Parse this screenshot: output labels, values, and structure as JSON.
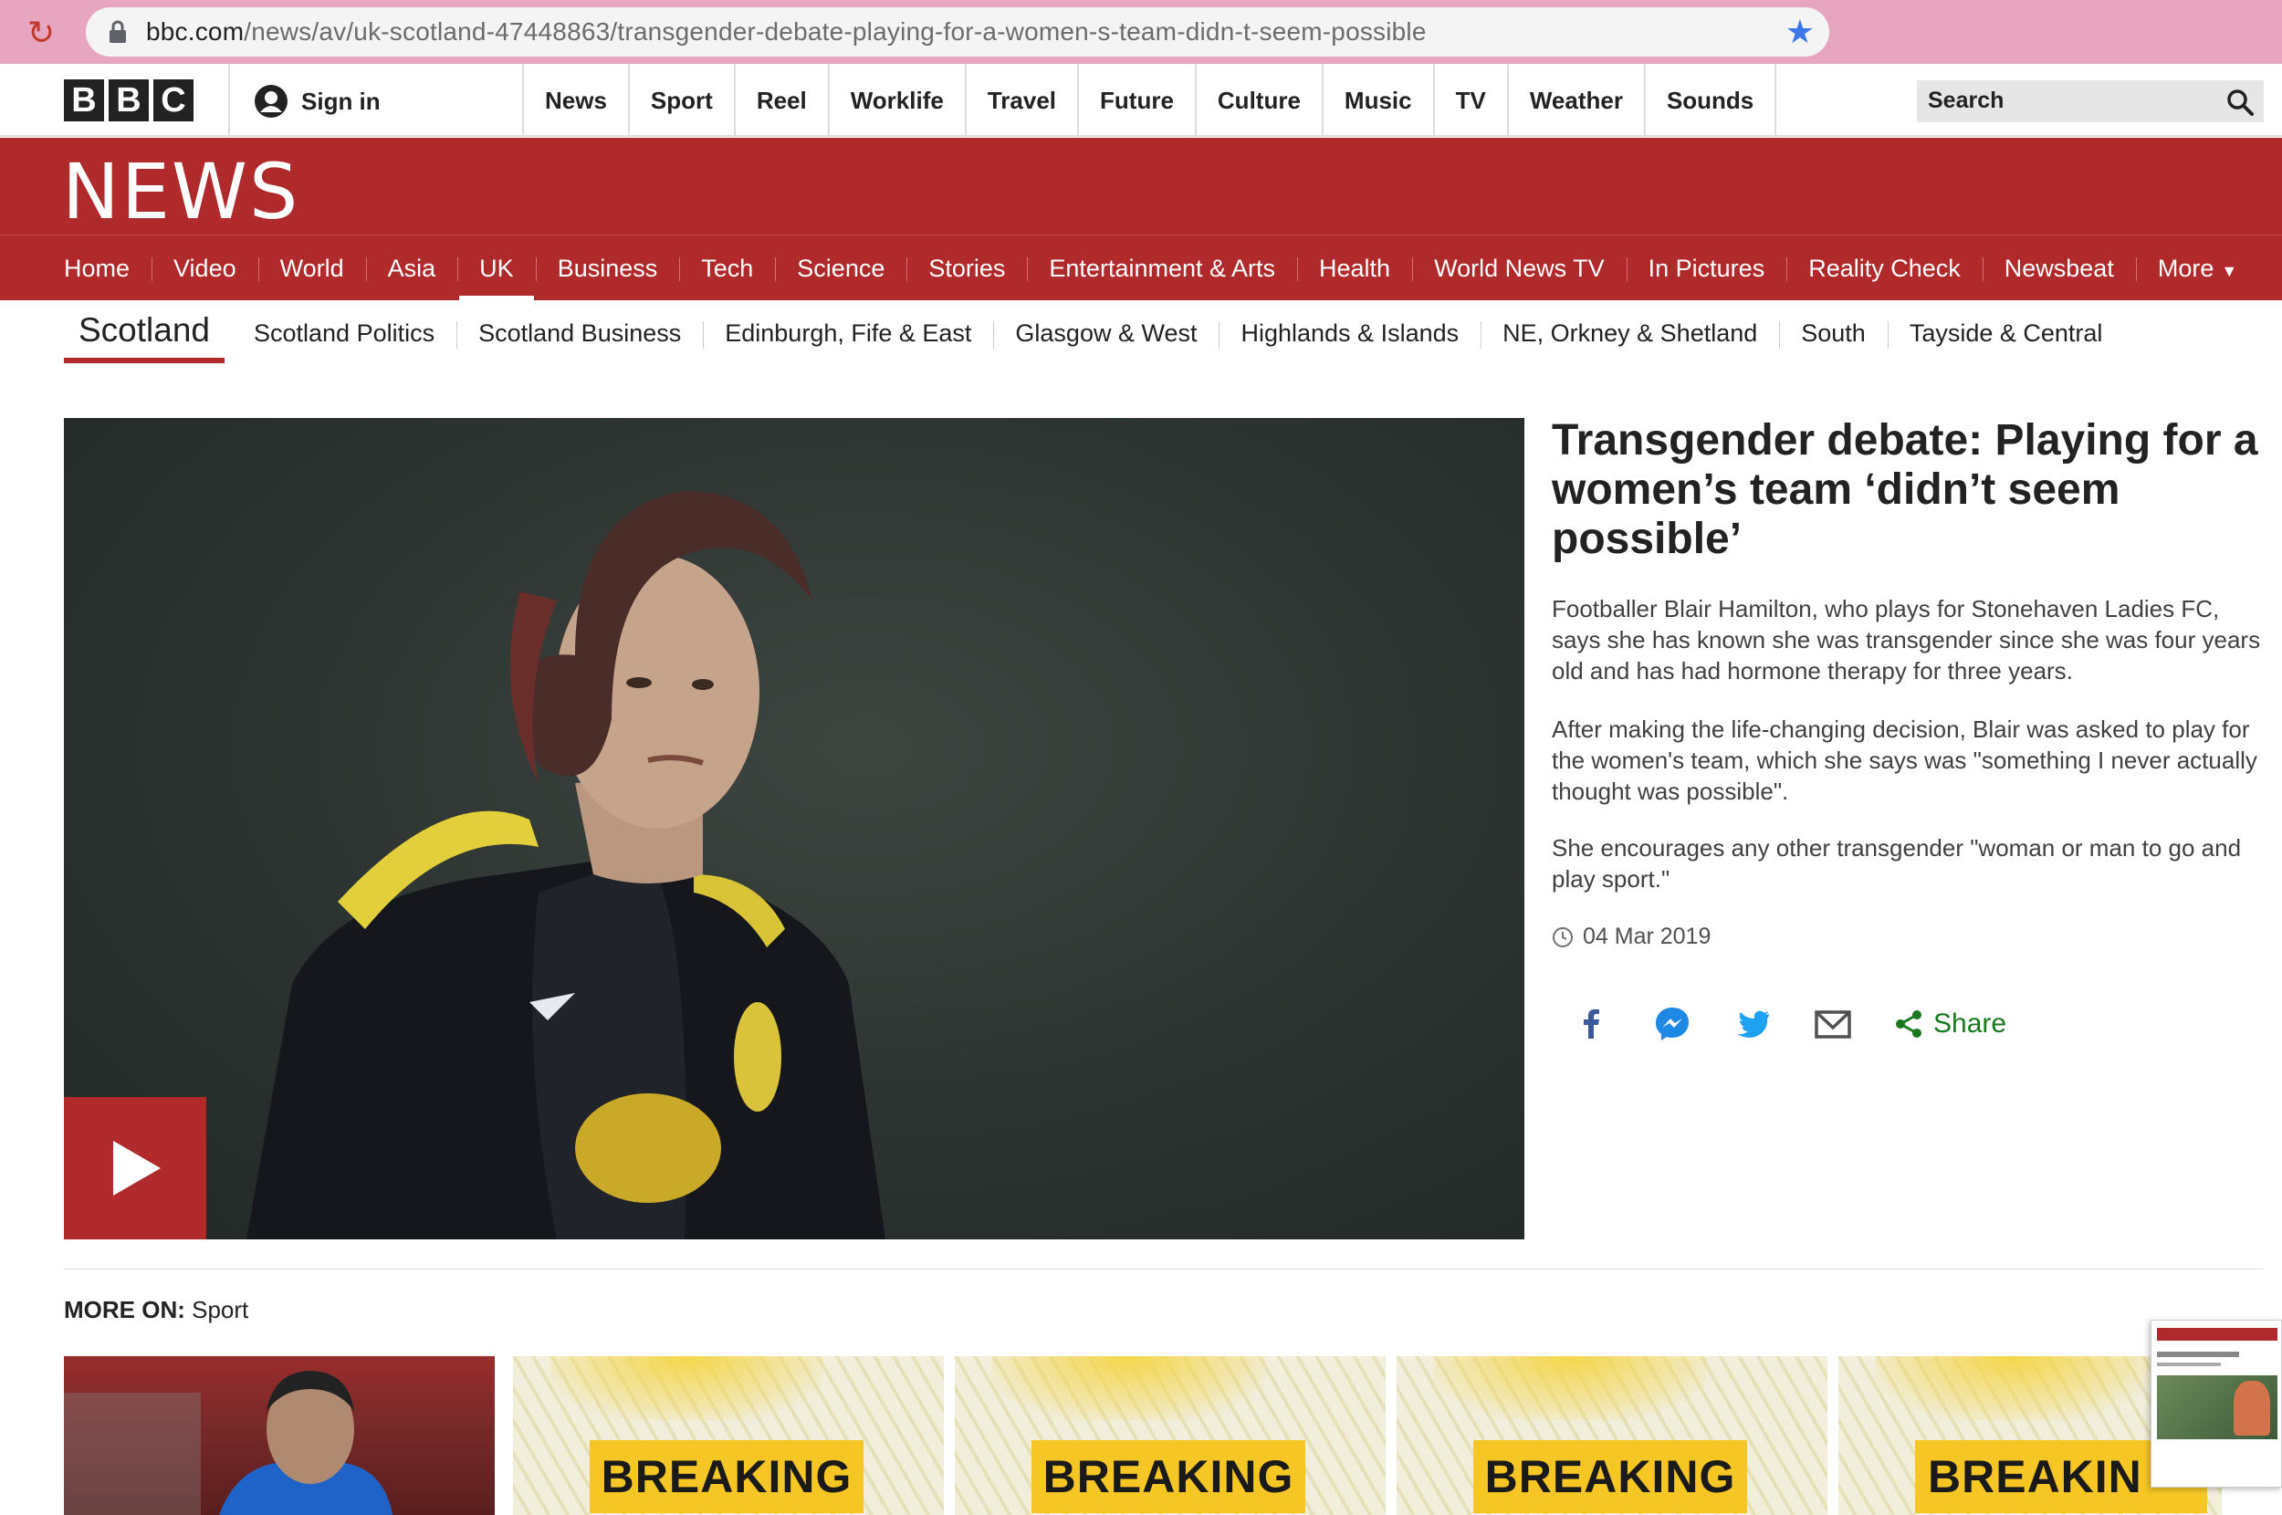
{
  "browser": {
    "url_host": "bbc.com",
    "url_path": "/news/av/uk-scotland-47448863/transgender-debate-playing-for-a-women-s-team-didn-t-seem-possible"
  },
  "global_nav": {
    "logo": [
      "B",
      "B",
      "C"
    ],
    "sign_in": "Sign in",
    "links": [
      "News",
      "Sport",
      "Reel",
      "Worklife",
      "Travel",
      "Future",
      "Culture",
      "Music",
      "TV",
      "Weather",
      "Sounds"
    ],
    "search_label": "Search"
  },
  "masthead": {
    "title": "NEWS"
  },
  "news_nav": {
    "items": [
      "Home",
      "Video",
      "World",
      "Asia",
      "UK",
      "Business",
      "Tech",
      "Science",
      "Stories",
      "Entertainment & Arts",
      "Health",
      "World News TV",
      "In Pictures",
      "Reality Check",
      "Newsbeat"
    ],
    "active": "UK",
    "more": "More"
  },
  "sub_nav": {
    "section": "Scotland",
    "items": [
      "Scotland Politics",
      "Scotland Business",
      "Edinburgh, Fife & East",
      "Glasgow & West",
      "Highlands & Islands",
      "NE, Orkney & Shetland",
      "South",
      "Tayside & Central"
    ]
  },
  "article": {
    "headline": "Transgender debate: Playing for a women’s team ‘didn’t seem possible’",
    "paragraphs": [
      "Footballer Blair Hamilton, who plays for Stonehaven Ladies FC, says she has known she was transgender since she was four years old and has had hormone therapy for three years.",
      "After making the life-changing decision, Blair was asked to play for the women's team, which she says was \"something I never actually thought was possible\".",
      "She encourages any other transgender \"woman or man to go and play sport.\""
    ],
    "date": "04 Mar 2019",
    "share_label": "Share",
    "share_icons": [
      "facebook-icon",
      "messenger-icon",
      "twitter-icon",
      "email-icon",
      "share-icon"
    ]
  },
  "more_on": {
    "prefix": "MORE ON:",
    "topic": "Sport",
    "cards": [
      {
        "type": "photo"
      },
      {
        "type": "breaking",
        "label": "BREAKING"
      },
      {
        "type": "breaking",
        "label": "BREAKING"
      },
      {
        "type": "breaking",
        "label": "BREAKING"
      },
      {
        "type": "breaking",
        "label": "BREAKIN"
      }
    ]
  },
  "colors": {
    "bbc_red": "#b0292b",
    "share_green": "#18791e",
    "breaking_yellow": "#f6c624",
    "browser_bar": "#e8a5bf"
  }
}
